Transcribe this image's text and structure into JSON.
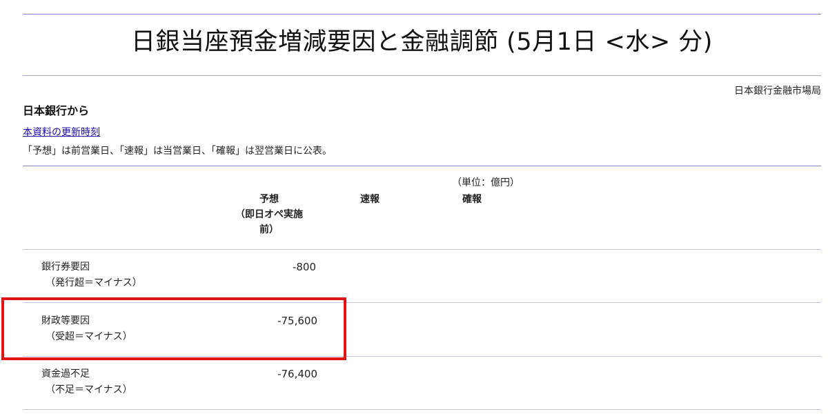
{
  "header": {
    "title": "日銀当座預金増減要因と金融調節 (5月1日 <水> 分)",
    "department": "日本銀行金融市場局"
  },
  "intro": {
    "source_heading": "日本銀行から",
    "update_link_label": "本資料の更新時刻",
    "publication_note": "「予想」は前営業日、「速報」は当営業日、「確報」は翌営業日に公表。"
  },
  "table": {
    "unit_label": "（単位：億円）",
    "columns": {
      "forecast_line1": "予想",
      "forecast_line2": "（即日オペ実施",
      "forecast_line3": "前）",
      "preliminary": "速報",
      "final": "確報"
    },
    "rows": [
      {
        "label": "銀行券要因",
        "sublabel": "（発行超＝マイナス）",
        "forecast": "-800",
        "highlighted": false
      },
      {
        "label": "財政等要因",
        "sublabel": "（受超＝マイナス）",
        "forecast": "-75,600",
        "highlighted": true
      },
      {
        "label": "資金過不足",
        "sublabel": "（不足＝マイナス）",
        "forecast": "-76,400",
        "highlighted": false
      }
    ]
  },
  "colors": {
    "rule": "#a9a6d8",
    "link": "#1a0dab",
    "highlight_border": "#e11414"
  }
}
